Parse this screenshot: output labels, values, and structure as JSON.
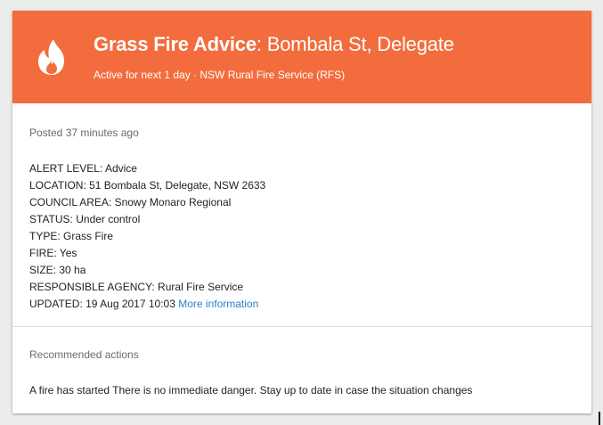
{
  "header": {
    "icon": "fire-icon",
    "title_bold": "Grass Fire Advice",
    "title_rest": ": Bombala St, Delegate",
    "subtitle": "Active for next 1 day · NSW Rural Fire Service (RFS)",
    "bg_color": "#f26c3d"
  },
  "body": {
    "posted": "Posted 37 minutes ago",
    "details": [
      "ALERT LEVEL: Advice",
      "LOCATION: 51 Bombala St, Delegate, NSW 2633",
      "COUNCIL AREA: Snowy Monaro Regional",
      "STATUS: Under control",
      "TYPE: Grass Fire",
      "FIRE: Yes",
      "SIZE: 30 ha",
      "RESPONSIBLE AGENCY: Rural Fire Service"
    ],
    "updated": "UPDATED: 19 Aug 2017 10:03",
    "more_info_link": "More information",
    "link_color": "#2a7fd6"
  },
  "recommended": {
    "title": "Recommended actions",
    "text": "A fire has started There is no immediate danger. Stay up to date in case the situation changes"
  }
}
